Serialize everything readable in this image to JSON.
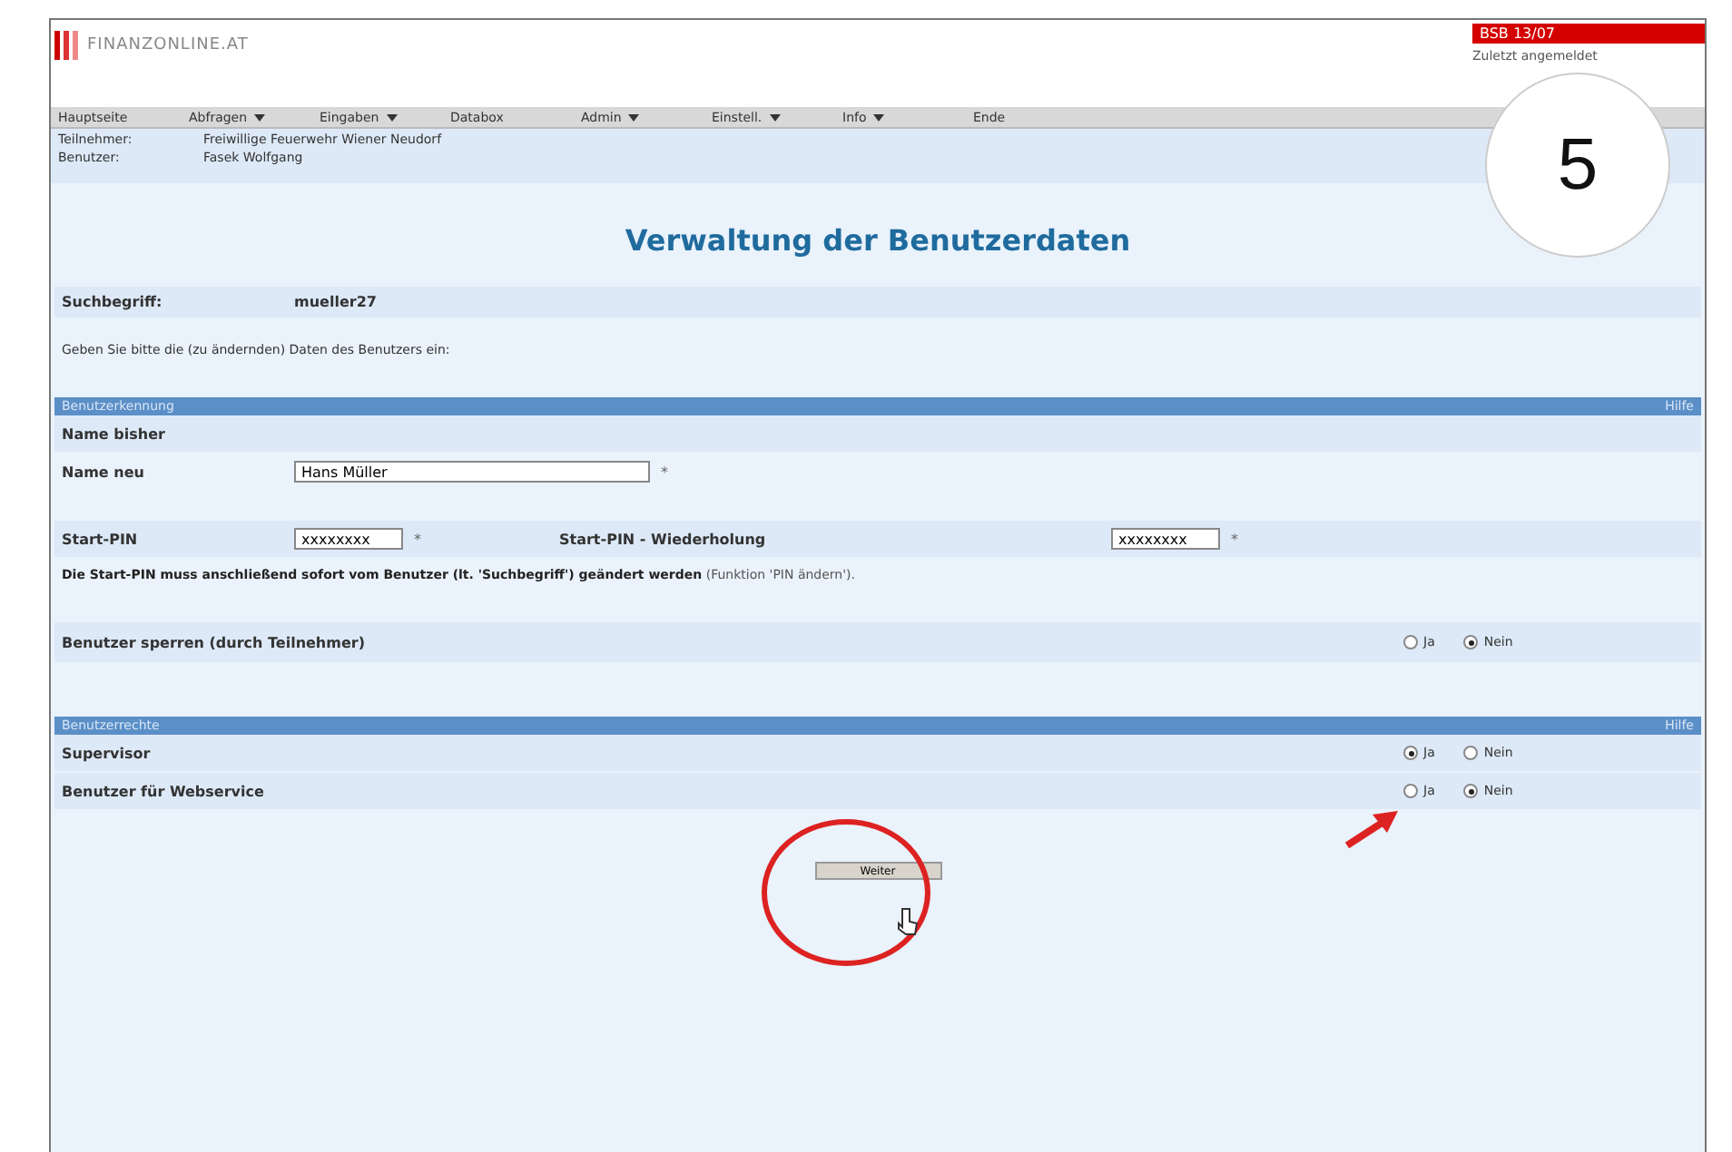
{
  "header": {
    "logo_text": "FINANZONLINE.AT",
    "badge": "BSB 13/07",
    "badge_note": "Zuletzt angemeldet"
  },
  "menu": [
    {
      "label": "Hauptseite",
      "dropdown": false
    },
    {
      "label": "Abfragen",
      "dropdown": true
    },
    {
      "label": "Eingaben",
      "dropdown": true
    },
    {
      "label": "Databox",
      "dropdown": false
    },
    {
      "label": "Admin",
      "dropdown": true
    },
    {
      "label": "Einstell.",
      "dropdown": true
    },
    {
      "label": "Info",
      "dropdown": true
    },
    {
      "label": "Ende",
      "dropdown": false
    }
  ],
  "info": [
    {
      "label": "Teilnehmer:",
      "value": "Freiwillige Feuerwehr Wiener Neudorf"
    },
    {
      "label": "Benutzer:",
      "value": "Fasek Wolfgang"
    }
  ],
  "title": "Verwaltung der Benutzerdaten",
  "suchbegriff": {
    "label": "Suchbegriff:",
    "value": "mueller27"
  },
  "intro": "Geben Sie bitte die (zu ändernden) Daten des Benutzers ein:",
  "section_1": {
    "title": "Benutzerkennung",
    "help": "Hilfe"
  },
  "name_old": {
    "label": "Name bisher"
  },
  "name_new": {
    "label": "Name neu",
    "value": "Hans Müller",
    "required": "*"
  },
  "pin": {
    "label": "Start-PIN",
    "value": "xxxxxxxx",
    "required": "*",
    "repeat_label": "Start-PIN - Wiederholung",
    "repeat_value": "xxxxxxxx",
    "repeat_required": "*"
  },
  "pin_note": {
    "bold": "Die Start-PIN muss anschließend sofort vom Benutzer (lt. 'Suchbegriff') geändert werden",
    "normal": "(Funktion 'PIN ändern')."
  },
  "lock_row": {
    "label": "Benutzer sperren (durch Teilnehmer)",
    "options": [
      {
        "label": "Ja",
        "selected": false
      },
      {
        "label": "Nein",
        "selected": true
      }
    ]
  },
  "section_2": {
    "title": "Benutzerrechte",
    "help": "Hilfe"
  },
  "rights": [
    {
      "label": "Supervisor",
      "options": [
        {
          "label": "Ja",
          "selected": true
        },
        {
          "label": "Nein",
          "selected": false
        }
      ]
    },
    {
      "label": "Benutzer für Webservice",
      "options": [
        {
          "label": "Ja",
          "selected": false
        },
        {
          "label": "Nein",
          "selected": true
        }
      ]
    }
  ],
  "button": "Weiter",
  "step": "5"
}
